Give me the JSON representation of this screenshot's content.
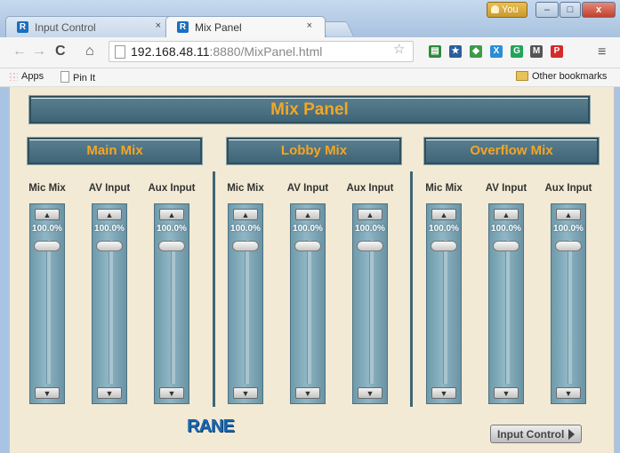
{
  "browser": {
    "tabs": [
      {
        "label": "Input Control",
        "icon": "R",
        "close": "×"
      },
      {
        "label": "Mix Panel",
        "icon": "R",
        "close": "×"
      }
    ],
    "user_chip": "You",
    "window_buttons": {
      "minimize": "–",
      "maximize": "□",
      "close": "x"
    },
    "url_host": "192.168.48.11",
    "url_rest": ":8880/MixPanel.html",
    "nav": {
      "back": "←",
      "forward": "→",
      "reload": "C",
      "home": "⌂"
    },
    "extensions": [
      {
        "name": "sheet-ext-icon",
        "glyph": "▤",
        "color": "#2e8b3a"
      },
      {
        "name": "puzzle-ext-icon",
        "glyph": "★",
        "color": "#2a5d9e"
      },
      {
        "name": "chameleon-ext-icon",
        "glyph": "◆",
        "color": "#3d9b4a"
      },
      {
        "name": "x-ext-icon",
        "glyph": "X",
        "color": "#2a8ed8"
      },
      {
        "name": "grammarly-ext-icon",
        "glyph": "G",
        "color": "#22a459"
      },
      {
        "name": "gmail-ext-icon",
        "glyph": "M",
        "color": "#555555"
      },
      {
        "name": "pinterest-ext-icon",
        "glyph": "P",
        "color": "#d42a2a"
      }
    ],
    "menu_icon": "≡",
    "bookmarks": {
      "apps": "Apps",
      "pin_it": "Pin It",
      "other": "Other bookmarks"
    }
  },
  "page": {
    "title": "Mix Panel",
    "sections": [
      {
        "title": "Main Mix",
        "channels": [
          {
            "label": "Mic Mix",
            "value": "100.0%",
            "level": 1.0
          },
          {
            "label": "AV Input",
            "value": "100.0%",
            "level": 1.0
          },
          {
            "label": "Aux Input",
            "value": "100.0%",
            "level": 1.0
          }
        ]
      },
      {
        "title": "Lobby Mix",
        "channels": [
          {
            "label": "Mic Mix",
            "value": "100.0%",
            "level": 1.0
          },
          {
            "label": "AV Input",
            "value": "100.0%",
            "level": 1.0
          },
          {
            "label": "Aux Input",
            "value": "100.0%",
            "level": 1.0
          }
        ]
      },
      {
        "title": "Overflow Mix",
        "channels": [
          {
            "label": "Mic Mix",
            "value": "100.0%",
            "level": 1.0
          },
          {
            "label": "AV Input",
            "value": "100.0%",
            "level": 1.0
          },
          {
            "label": "Aux Input",
            "value": "100.0%",
            "level": 1.0
          }
        ]
      }
    ],
    "arrow_up": "▲",
    "arrow_down": "▼",
    "logo_text": "RANE",
    "input_control_button": "Input Control",
    "accent_color": "#f5a623",
    "panel_color": "#4a7080"
  }
}
